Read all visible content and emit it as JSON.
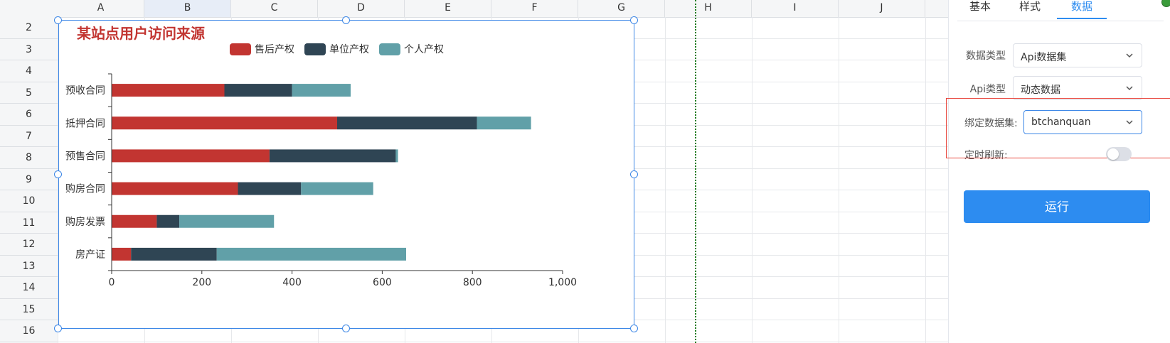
{
  "sheet": {
    "columns": [
      "A",
      "B",
      "C",
      "D",
      "E",
      "F",
      "G",
      "H",
      "I",
      "J"
    ],
    "selected_column": "B",
    "rows": [
      "2",
      "3",
      "4",
      "5",
      "6",
      "7",
      "8",
      "9",
      "10",
      "11",
      "12",
      "13",
      "14",
      "15",
      "16"
    ]
  },
  "chart_data": {
    "type": "bar",
    "orientation": "horizontal",
    "stacked": true,
    "title": "某站点用户访问来源",
    "categories": [
      "预收合同",
      "抵押合同",
      "预售合同",
      "购房合同",
      "购房发票",
      "房产证"
    ],
    "series": [
      {
        "name": "售后产权",
        "color": "#c23531",
        "values": [
          250,
          500,
          350,
          280,
          100,
          43
        ]
      },
      {
        "name": "单位产权",
        "color": "#2f4554",
        "values": [
          150,
          310,
          280,
          140,
          50,
          190
        ]
      },
      {
        "name": "个人产权",
        "color": "#61a0a8",
        "values": [
          130,
          120,
          5,
          160,
          210,
          420
        ]
      }
    ],
    "xlim": [
      0,
      1000
    ],
    "x_ticks": [
      "0",
      "200",
      "400",
      "600",
      "800",
      "1,000"
    ],
    "legend_position": "top-center",
    "grid": false
  },
  "panel": {
    "tabs": [
      {
        "label": "基本",
        "active": false
      },
      {
        "label": "样式",
        "active": false
      },
      {
        "label": "数据",
        "active": true
      }
    ],
    "fields": {
      "data_type": {
        "label": "数据类型",
        "value": "Api数据集"
      },
      "api_type": {
        "label": "Api类型",
        "value": "动态数据"
      },
      "bind_dataset": {
        "label": "绑定数据集:",
        "value": "btchanquan"
      },
      "timed_refresh": {
        "label": "定时刷新:",
        "on": false
      }
    },
    "run_label": "运行"
  },
  "colors": {
    "accent": "#2d8cf0",
    "selection": "#3b86e6",
    "highlight": "#e8453c"
  }
}
